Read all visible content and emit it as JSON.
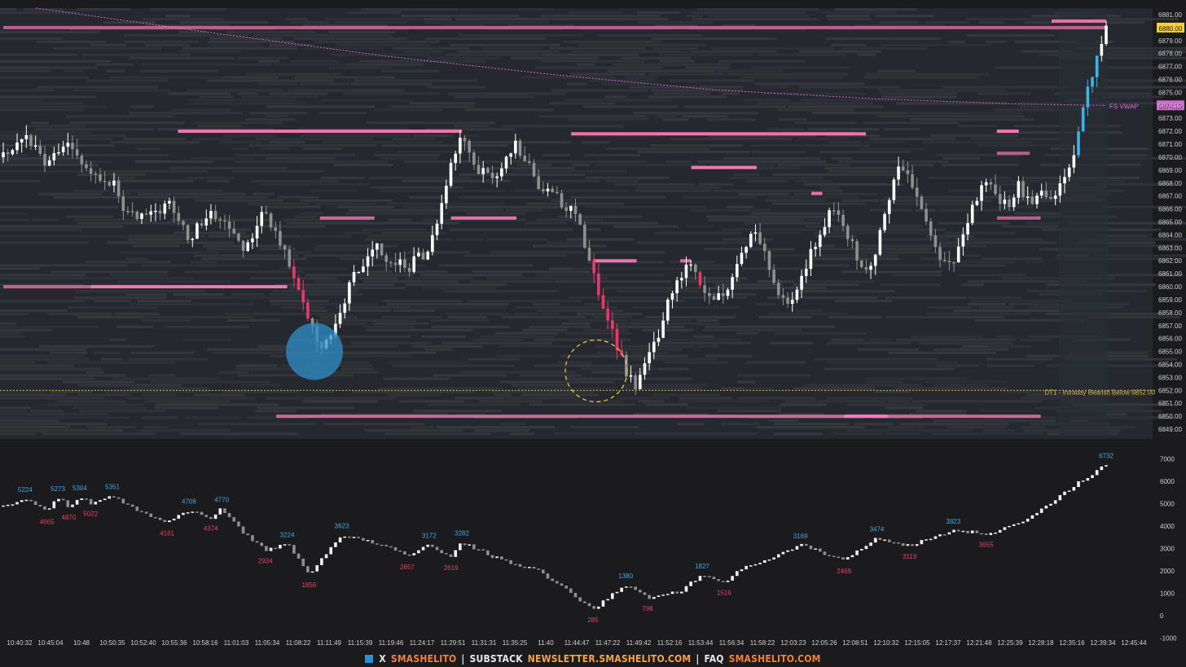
{
  "chart_data": [
    {
      "type": "bar",
      "subtype": "candlestick-with-volume-profile-heatmap",
      "x_tick_labels": [
        "10:40:32",
        "10:45:04",
        "10:48",
        "10:50:35",
        "10:52:40",
        "10:55:36",
        "10:58:16",
        "11:01:03",
        "11:05:34",
        "11:08:22",
        "11:11:49",
        "11:15:39",
        "11:19:46",
        "11:24:17",
        "11:29:51",
        "11:31:31",
        "11:35:25",
        "11:40",
        "11:44:47",
        "11:47:22",
        "11:49:42",
        "11:52:16",
        "11:53:44",
        "11:56:34",
        "11:58:22",
        "12:03:23",
        "12:05:26",
        "12:08:51",
        "12:10:32",
        "12:15:05",
        "12:17:37",
        "12:21:48",
        "12:25:39",
        "12:28:18",
        "12:35:16",
        "12:39:34",
        "12:45:44"
      ],
      "y_tick_labels": [
        "6881.00",
        "6880.00",
        "6879.00",
        "6878.00",
        "6877.00",
        "6876.00",
        "6875.00",
        "6874.00",
        "6873.00",
        "6872.00",
        "6871.00",
        "6870.00",
        "6869.00",
        "6868.00",
        "6867.00",
        "6866.00",
        "6865.00",
        "6864.00",
        "6863.00",
        "6862.00",
        "6861.00",
        "6860.00",
        "6859.00",
        "6858.00",
        "6857.00",
        "6856.00",
        "6855.00",
        "6854.00",
        "6853.00",
        "6852.00",
        "6851.00",
        "6850.00",
        "6849.00"
      ],
      "ylim": [
        6848.5,
        6881.5
      ],
      "price_path": [
        {
          "x": 0,
          "y": 6870.0
        },
        {
          "x": 2,
          "y": 6871.5
        },
        {
          "x": 4,
          "y": 6869.5
        },
        {
          "x": 6,
          "y": 6871.0
        },
        {
          "x": 8,
          "y": 6869.0
        },
        {
          "x": 10,
          "y": 6868.0
        },
        {
          "x": 11,
          "y": 6866.0
        },
        {
          "x": 13,
          "y": 6865.0
        },
        {
          "x": 15,
          "y": 6866.5
        },
        {
          "x": 17,
          "y": 6863.5
        },
        {
          "x": 19,
          "y": 6866.0
        },
        {
          "x": 21,
          "y": 6864.5
        },
        {
          "x": 22,
          "y": 6862.5
        },
        {
          "x": 24,
          "y": 6866.0
        },
        {
          "x": 25,
          "y": 6864.0
        },
        {
          "x": 26,
          "y": 6862.5
        },
        {
          "x": 27,
          "y": 6860.0
        },
        {
          "x": 28,
          "y": 6857.0
        },
        {
          "x": 29,
          "y": 6855.5
        },
        {
          "x": 30,
          "y": 6856.0
        },
        {
          "x": 31,
          "y": 6858.5
        },
        {
          "x": 32,
          "y": 6861.0
        },
        {
          "x": 33,
          "y": 6862.0
        },
        {
          "x": 34,
          "y": 6863.5
        },
        {
          "x": 35,
          "y": 6862.0
        },
        {
          "x": 37,
          "y": 6861.5
        },
        {
          "x": 39,
          "y": 6863.0
        },
        {
          "x": 40,
          "y": 6866.0
        },
        {
          "x": 41,
          "y": 6870.0
        },
        {
          "x": 42,
          "y": 6871.5
        },
        {
          "x": 43,
          "y": 6869.5
        },
        {
          "x": 45,
          "y": 6868.0
        },
        {
          "x": 47,
          "y": 6871.0
        },
        {
          "x": 49,
          "y": 6868.0
        },
        {
          "x": 51,
          "y": 6866.5
        },
        {
          "x": 52,
          "y": 6866.0
        },
        {
          "x": 53,
          "y": 6864.0
        },
        {
          "x": 54,
          "y": 6861.0
        },
        {
          "x": 55,
          "y": 6858.5
        },
        {
          "x": 56,
          "y": 6856.0
        },
        {
          "x": 57,
          "y": 6853.5
        },
        {
          "x": 58,
          "y": 6852.3
        },
        {
          "x": 59,
          "y": 6854.5
        },
        {
          "x": 60,
          "y": 6856.5
        },
        {
          "x": 61,
          "y": 6859.0
        },
        {
          "x": 62,
          "y": 6861.0
        },
        {
          "x": 63,
          "y": 6862.0
        },
        {
          "x": 64,
          "y": 6860.0
        },
        {
          "x": 65,
          "y": 6858.5
        },
        {
          "x": 66,
          "y": 6859.5
        },
        {
          "x": 67,
          "y": 6861.0
        },
        {
          "x": 68,
          "y": 6863.5
        },
        {
          "x": 69,
          "y": 6864.5
        },
        {
          "x": 70,
          "y": 6862.0
        },
        {
          "x": 71,
          "y": 6859.5
        },
        {
          "x": 72,
          "y": 6859.0
        },
        {
          "x": 73,
          "y": 6860.5
        },
        {
          "x": 74,
          "y": 6862.5
        },
        {
          "x": 75,
          "y": 6864.5
        },
        {
          "x": 76,
          "y": 6866.5
        },
        {
          "x": 77,
          "y": 6865.0
        },
        {
          "x": 78,
          "y": 6862.5
        },
        {
          "x": 79,
          "y": 6861.0
        },
        {
          "x": 80,
          "y": 6863.0
        },
        {
          "x": 81,
          "y": 6866.5
        },
        {
          "x": 82,
          "y": 6869.5
        },
        {
          "x": 83,
          "y": 6868.0
        },
        {
          "x": 84,
          "y": 6866.5
        },
        {
          "x": 85,
          "y": 6864.0
        },
        {
          "x": 86,
          "y": 6862.0
        },
        {
          "x": 87,
          "y": 6861.5
        },
        {
          "x": 88,
          "y": 6864.0
        },
        {
          "x": 89,
          "y": 6866.5
        },
        {
          "x": 90,
          "y": 6868.5
        },
        {
          "x": 91,
          "y": 6867.0
        },
        {
          "x": 92,
          "y": 6866.0
        },
        {
          "x": 93,
          "y": 6868.0
        },
        {
          "x": 94,
          "y": 6866.5
        },
        {
          "x": 95,
          "y": 6867.5
        },
        {
          "x": 96,
          "y": 6866.5
        },
        {
          "x": 97,
          "y": 6868.0
        },
        {
          "x": 98,
          "y": 6870.5
        },
        {
          "x": 99,
          "y": 6874.0
        },
        {
          "x": 100,
          "y": 6877.5
        },
        {
          "x": 101,
          "y": 6880.0
        }
      ],
      "heatmap_levels": [
        {
          "y": 6880.0,
          "x_start": 0,
          "x_end": 101,
          "intensity": 0.55
        },
        {
          "y": 6880.5,
          "x_start": 96,
          "x_end": 101,
          "intensity": 0.9
        },
        {
          "y": 6872.0,
          "x_start": 16,
          "x_end": 42,
          "intensity": 1.0
        },
        {
          "y": 6871.8,
          "x_start": 52,
          "x_end": 79,
          "intensity": 0.95
        },
        {
          "y": 6872.0,
          "x_start": 91,
          "x_end": 93,
          "intensity": 1.0
        },
        {
          "y": 6869.2,
          "x_start": 63,
          "x_end": 69,
          "intensity": 1.0
        },
        {
          "y": 6867.2,
          "x_start": 74,
          "x_end": 75,
          "intensity": 0.9
        },
        {
          "y": 6865.3,
          "x_start": 41,
          "x_end": 47,
          "intensity": 0.9
        },
        {
          "y": 6865.3,
          "x_start": 29,
          "x_end": 34,
          "intensity": 0.7
        },
        {
          "y": 6865.3,
          "x_start": 91,
          "x_end": 95,
          "intensity": 0.55
        },
        {
          "y": 6870.3,
          "x_start": 91,
          "x_end": 94,
          "intensity": 0.55
        },
        {
          "y": 6862.0,
          "x_start": 54,
          "x_end": 58,
          "intensity": 0.95
        },
        {
          "y": 6862.0,
          "x_start": 62,
          "x_end": 63,
          "intensity": 0.8
        },
        {
          "y": 6860.0,
          "x_start": 8,
          "x_end": 26,
          "intensity": 1.0
        },
        {
          "y": 6860.0,
          "x_start": 0,
          "x_end": 8,
          "intensity": 0.6
        },
        {
          "y": 6850.0,
          "x_start": 25,
          "x_end": 95,
          "intensity": 0.7
        },
        {
          "y": 6850.0,
          "x_start": 77,
          "x_end": 81,
          "intensity": 1.0
        }
      ],
      "vwap_line": [
        {
          "x": 3,
          "y": 6881.5
        },
        {
          "x": 20,
          "y": 6879.5
        },
        {
          "x": 35,
          "y": 6877.8
        },
        {
          "x": 50,
          "y": 6876.4
        },
        {
          "x": 65,
          "y": 6875.2
        },
        {
          "x": 80,
          "y": 6874.5
        },
        {
          "x": 93,
          "y": 6874.1
        },
        {
          "x": 101,
          "y": 6874.0
        }
      ],
      "vwap_label": "FS VWAP",
      "vwap_value": "6874.20",
      "last_price_label": "6880.00",
      "level_line": {
        "y": 6852.0,
        "label": "DT1 - Intraday Bearish Below  6852.00"
      },
      "highlights": [
        {
          "x": 28.5,
          "y": 6855.0,
          "kind": "filled-circle"
        },
        {
          "x": 54.3,
          "y": 6853.5,
          "kind": "dashed-circle"
        }
      ],
      "colors": {
        "background": "#1b1b1d",
        "heatmap_bg": "#25282f",
        "level": "#ff7ab8",
        "up_candle": "#ffffff",
        "down_candle": "#8f8f8f",
        "buy_absorb": "#3fb2e8",
        "sell_absorb": "#e8396a",
        "vwap": "#d466d6",
        "level_line": "#d9b64d",
        "price_tag": "#f3d330"
      }
    },
    {
      "type": "line",
      "subtype": "cumulative-delta-candles",
      "y_tick_labels": [
        "7000",
        "6000",
        "5000",
        "4000",
        "3000",
        "2000",
        "1000",
        "0",
        "-1000"
      ],
      "ylim": [
        -1050,
        7300
      ],
      "delta_path": [
        {
          "x": 0,
          "y": 4900
        },
        {
          "x": 2,
          "y": 5224
        },
        {
          "x": 4,
          "y": 4665
        },
        {
          "x": 5,
          "y": 5273
        },
        {
          "x": 6,
          "y": 4870
        },
        {
          "x": 7,
          "y": 5304
        },
        {
          "x": 8,
          "y": 5022
        },
        {
          "x": 10,
          "y": 5351
        },
        {
          "x": 12,
          "y": 4750
        },
        {
          "x": 15,
          "y": 4161
        },
        {
          "x": 17,
          "y": 4708
        },
        {
          "x": 19,
          "y": 4374
        },
        {
          "x": 20,
          "y": 4770
        },
        {
          "x": 22,
          "y": 3700
        },
        {
          "x": 24,
          "y": 2934
        },
        {
          "x": 26,
          "y": 3224
        },
        {
          "x": 28,
          "y": 1856
        },
        {
          "x": 31,
          "y": 3623
        },
        {
          "x": 35,
          "y": 3100
        },
        {
          "x": 37,
          "y": 2657
        },
        {
          "x": 39,
          "y": 3172
        },
        {
          "x": 41,
          "y": 2619
        },
        {
          "x": 42,
          "y": 3282
        },
        {
          "x": 45,
          "y": 2600
        },
        {
          "x": 49,
          "y": 2000
        },
        {
          "x": 52,
          "y": 1000
        },
        {
          "x": 54,
          "y": 285
        },
        {
          "x": 57,
          "y": 1380
        },
        {
          "x": 59,
          "y": 798
        },
        {
          "x": 62,
          "y": 1100
        },
        {
          "x": 64,
          "y": 1827
        },
        {
          "x": 66,
          "y": 1516
        },
        {
          "x": 68,
          "y": 2200
        },
        {
          "x": 71,
          "y": 2700
        },
        {
          "x": 73,
          "y": 3169
        },
        {
          "x": 77,
          "y": 2469
        },
        {
          "x": 80,
          "y": 3474
        },
        {
          "x": 83,
          "y": 3119
        },
        {
          "x": 87,
          "y": 3823
        },
        {
          "x": 90,
          "y": 3655
        },
        {
          "x": 93,
          "y": 4100
        },
        {
          "x": 96,
          "y": 5000
        },
        {
          "x": 98,
          "y": 5800
        },
        {
          "x": 101,
          "y": 6732
        }
      ],
      "peak_labels": [
        {
          "x": 2,
          "value": "5224"
        },
        {
          "x": 5,
          "value": "5273"
        },
        {
          "x": 7,
          "value": "5304"
        },
        {
          "x": 10,
          "value": "5351"
        },
        {
          "x": 17,
          "value": "4708"
        },
        {
          "x": 20,
          "value": "4770"
        },
        {
          "x": 26,
          "value": "3224"
        },
        {
          "x": 31,
          "value": "3623"
        },
        {
          "x": 39,
          "value": "3172"
        },
        {
          "x": 42,
          "value": "3282"
        },
        {
          "x": 57,
          "value": "1380"
        },
        {
          "x": 64,
          "value": "1827"
        },
        {
          "x": 73,
          "value": "3169"
        },
        {
          "x": 80,
          "value": "3474"
        },
        {
          "x": 87,
          "value": "3823"
        },
        {
          "x": 101,
          "value": "6732"
        }
      ],
      "trough_labels": [
        {
          "x": 4,
          "value": "4665"
        },
        {
          "x": 6,
          "value": "4870"
        },
        {
          "x": 8,
          "value": "5022"
        },
        {
          "x": 15,
          "value": "4161"
        },
        {
          "x": 19,
          "value": "4374"
        },
        {
          "x": 24,
          "value": "2934"
        },
        {
          "x": 28,
          "value": "1856"
        },
        {
          "x": 37,
          "value": "2657"
        },
        {
          "x": 41,
          "value": "2619"
        },
        {
          "x": 54,
          "value": "285"
        },
        {
          "x": 59,
          "value": "798"
        },
        {
          "x": 66,
          "value": "1516"
        },
        {
          "x": 77,
          "value": "2469"
        },
        {
          "x": 83,
          "value": "3119"
        },
        {
          "x": 90,
          "value": "3655"
        }
      ],
      "colors": {
        "peak_label": "#3fa8e6",
        "trough_label": "#e8405f",
        "candle": "#e6e6e6"
      }
    }
  ],
  "footer": {
    "x_label": "X",
    "x_handle": "SMASHELITO",
    "substack_label": "SUBSTACK",
    "substack_url": "NEWSLETTER.SMASHELITO.COM",
    "faq_label": "FAQ",
    "faq_url": "SMASHELITO.COM",
    "separator": "|"
  }
}
